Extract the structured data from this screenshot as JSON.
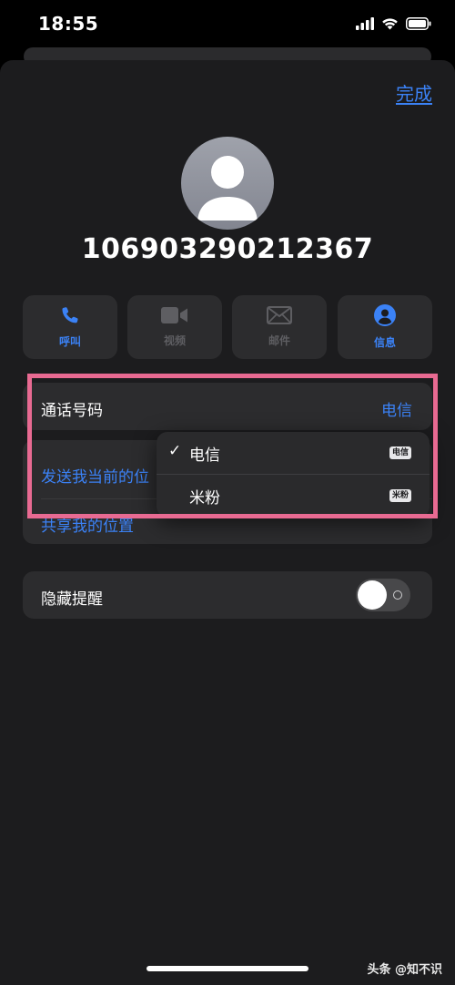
{
  "status_bar": {
    "time": "18:55"
  },
  "header": {
    "done_label": "完成"
  },
  "contact": {
    "phone_number": "106903290212367"
  },
  "actions": [
    {
      "label": "呼叫",
      "icon": "phone-icon",
      "enabled": true
    },
    {
      "label": "视频",
      "icon": "video-icon",
      "enabled": false
    },
    {
      "label": "邮件",
      "icon": "mail-icon",
      "enabled": false
    },
    {
      "label": "信息",
      "icon": "message-icon",
      "enabled": true
    }
  ],
  "call_number": {
    "label": "通话号码",
    "value": "电信"
  },
  "location": {
    "send_label": "发送我当前的位",
    "share_label": "共享我的位置"
  },
  "dropdown": {
    "options": [
      {
        "label": "电信",
        "badge": "电信",
        "selected": true
      },
      {
        "label": "米粉",
        "badge": "米粉",
        "selected": false
      }
    ]
  },
  "hide_alerts": {
    "label": "隐藏提醒",
    "enabled": false
  },
  "watermark": "头条 @知不识",
  "colors": {
    "accent": "#3b82f6",
    "highlight": "#e86a92",
    "card": "#2c2c2e",
    "sheet": "#1c1c1e"
  }
}
